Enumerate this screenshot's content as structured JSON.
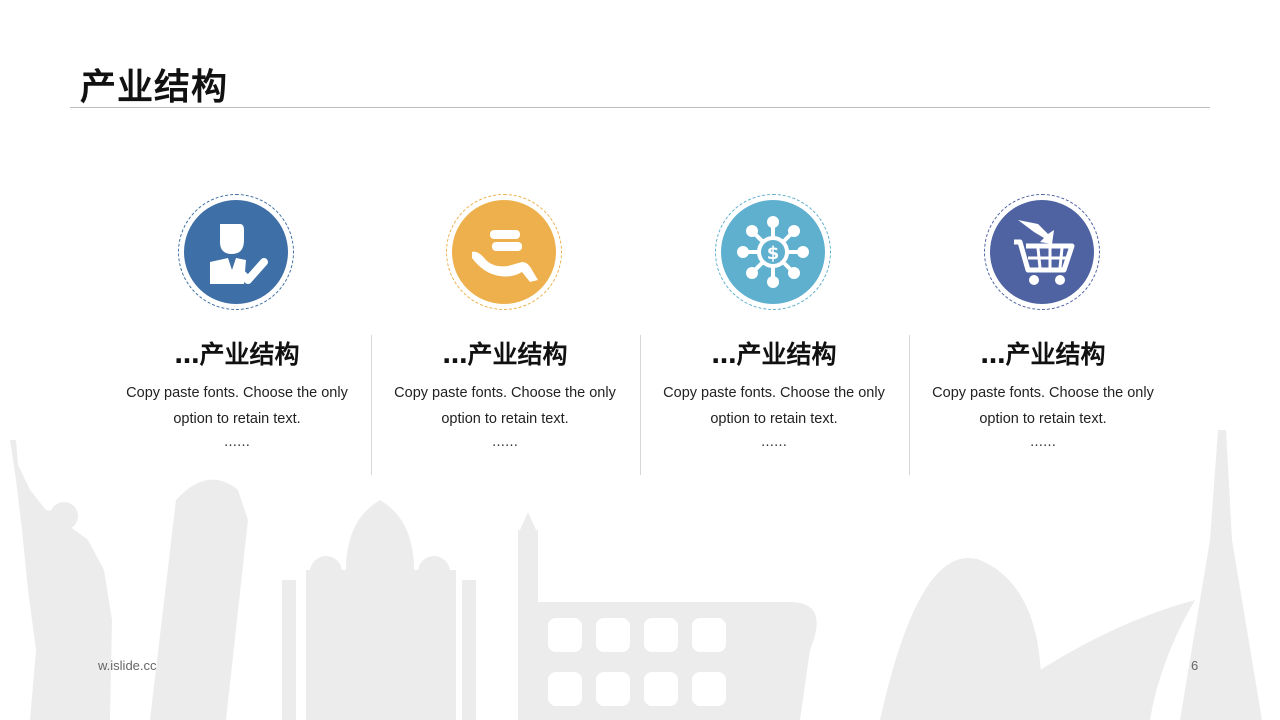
{
  "slide": {
    "title": "产业结构",
    "footer_url": "w.islide.cc",
    "page_number": "6"
  },
  "columns": [
    {
      "heading": "…产业结构",
      "desc_line1": "Copy paste fonts. Choose the only",
      "desc_line2": "option to retain text.",
      "more": "……",
      "icon": "person-check-icon",
      "color": "#3e6fa6"
    },
    {
      "heading": "…产业结构",
      "desc_line1": "Copy paste fonts. Choose the only",
      "desc_line2": "option to retain text.",
      "more": "……",
      "icon": "hand-coins-icon",
      "color": "#eeb04c"
    },
    {
      "heading": "…产业结构",
      "desc_line1": "Copy paste fonts. Choose the only",
      "desc_line2": "option to retain text.",
      "more": "……",
      "icon": "dollar-network-icon",
      "color": "#5fb0cf"
    },
    {
      "heading": "…产业结构",
      "desc_line1": "Copy paste fonts. Choose the only",
      "desc_line2": "option to retain text.",
      "more": "……",
      "icon": "shopping-cart-icon",
      "color": "#4f63a3"
    }
  ]
}
